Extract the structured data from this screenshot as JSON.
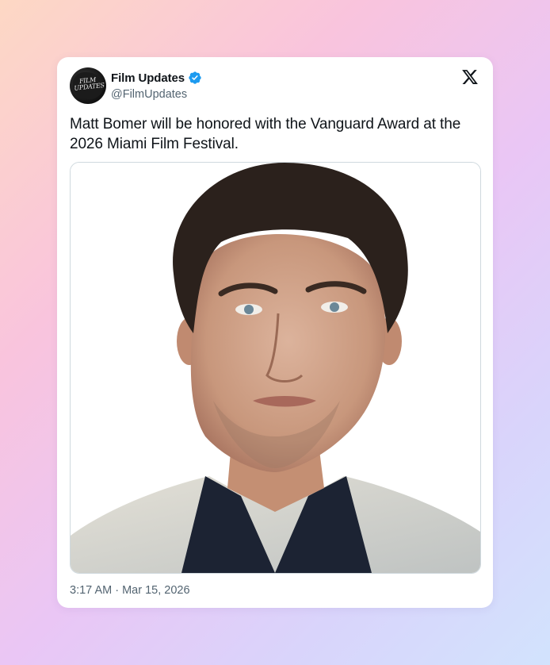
{
  "tweet": {
    "author_name": "Film Updates",
    "author_handle": "@FilmUpdates",
    "avatar_text": "FILM UPDATES",
    "verified": true,
    "text": "Matt Bomer will be honored with the Vanguard Award at the 2026 Miami Film Festival.",
    "timestamp": "3:17 AM · Mar 15, 2026",
    "platform_icon": "x-logo-icon",
    "media_icon": "portrait-photo"
  },
  "colors": {
    "text_primary": "#0f1419",
    "text_secondary": "#536471",
    "verified_blue": "#1d9bf0",
    "card_bg": "#ffffff"
  }
}
